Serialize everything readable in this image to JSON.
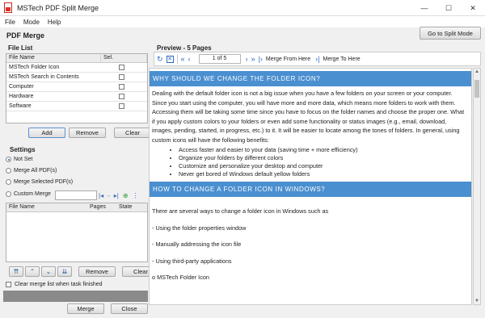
{
  "window": {
    "title": "MSTech PDF Split Merge",
    "controls": [
      "—",
      "☐",
      "✕"
    ]
  },
  "menu": [
    "File",
    "Mode",
    "Help"
  ],
  "page_title": "PDF Merge",
  "goto_button": "Go to Split Mode",
  "file_list": {
    "label": "File List",
    "columns": [
      "File Name",
      "Sel."
    ],
    "rows": [
      "MSTech Folder Icon",
      "MSTech Search in Contents",
      "Computer",
      "Hardware",
      "Software"
    ],
    "buttons": [
      "Add",
      "Remove",
      "Clear"
    ]
  },
  "settings": {
    "label": "Settings",
    "options": [
      "Not Set",
      "Merge All PDF(s)",
      "Merge Selected PDF(s)",
      "Custom Merge"
    ],
    "selected_index": 0,
    "merge_columns": [
      "File Name",
      "Pages",
      "State"
    ],
    "order_buttons": [
      "⇈",
      "⌃",
      "⌄",
      "⇊"
    ],
    "buttons": [
      "Remove",
      "Clear"
    ],
    "clear_checkbox": "Clear merge list when task finished"
  },
  "bottom_buttons": [
    "Merge",
    "Close"
  ],
  "preview": {
    "label": "Preview - 5 Pages",
    "page_counter": "1 of 5",
    "merge_from_here": "Merge From Here",
    "merge_to_here": "Merge To Here"
  },
  "document": {
    "heading1": "WHY SHOULD WE CHANGE THE FOLDER ICON?",
    "paragraph1": "Dealing with the default folder icon is not a big issue when you have a few folders on your screen or your computer. Since you start using the computer, you will have more and more data, which means more folders to work with them. Accessing them will be taking some time since you have to focus on the folder names and choose the proper one. What if you apply custom colors to your folders or even add some functionality or status images (e.g., email, download, images, pending, started, in progress, etc.) to it. It will be easier to locate among the tones of folders. In general, using custom icons will have the following benefits:",
    "bullets": [
      "Access faster and easier to your data (saving time + more efficiency)",
      "Organize your folders by different colors",
      "Customize and personalize your desktop and computer",
      "Never get bored of Windows default yellow folders"
    ],
    "heading2": "HOW TO CHANGE A FOLDER ICON IN WINDOWS?",
    "paragraph2": "There are several ways to change a folder icon in Windows such as",
    "items": [
      "- Using the folder properties window",
      "- Manually addressing the icon file",
      "- Using third-party applications",
      "o MSTech Folder Icon"
    ]
  }
}
